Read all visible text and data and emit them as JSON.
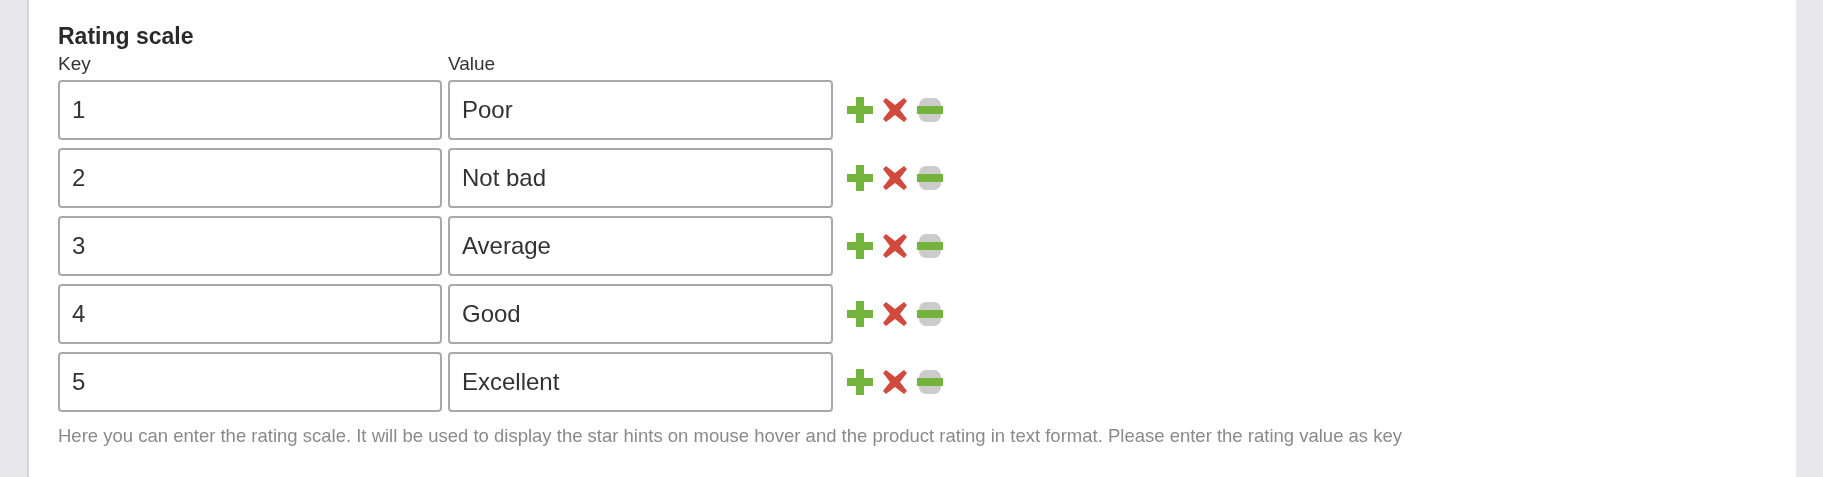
{
  "section": {
    "title": "Rating scale",
    "columns": [
      "Key",
      "Value"
    ],
    "rows": [
      {
        "key": "1",
        "value": "Poor"
      },
      {
        "key": "2",
        "value": "Not bad"
      },
      {
        "key": "3",
        "value": "Average"
      },
      {
        "key": "4",
        "value": "Good"
      },
      {
        "key": "5",
        "value": "Excellent"
      }
    ],
    "help": "Here you can enter the rating scale. It will be used to display the star hints on mouse hover and the product rating in text format. Please enter the rating value as key"
  }
}
